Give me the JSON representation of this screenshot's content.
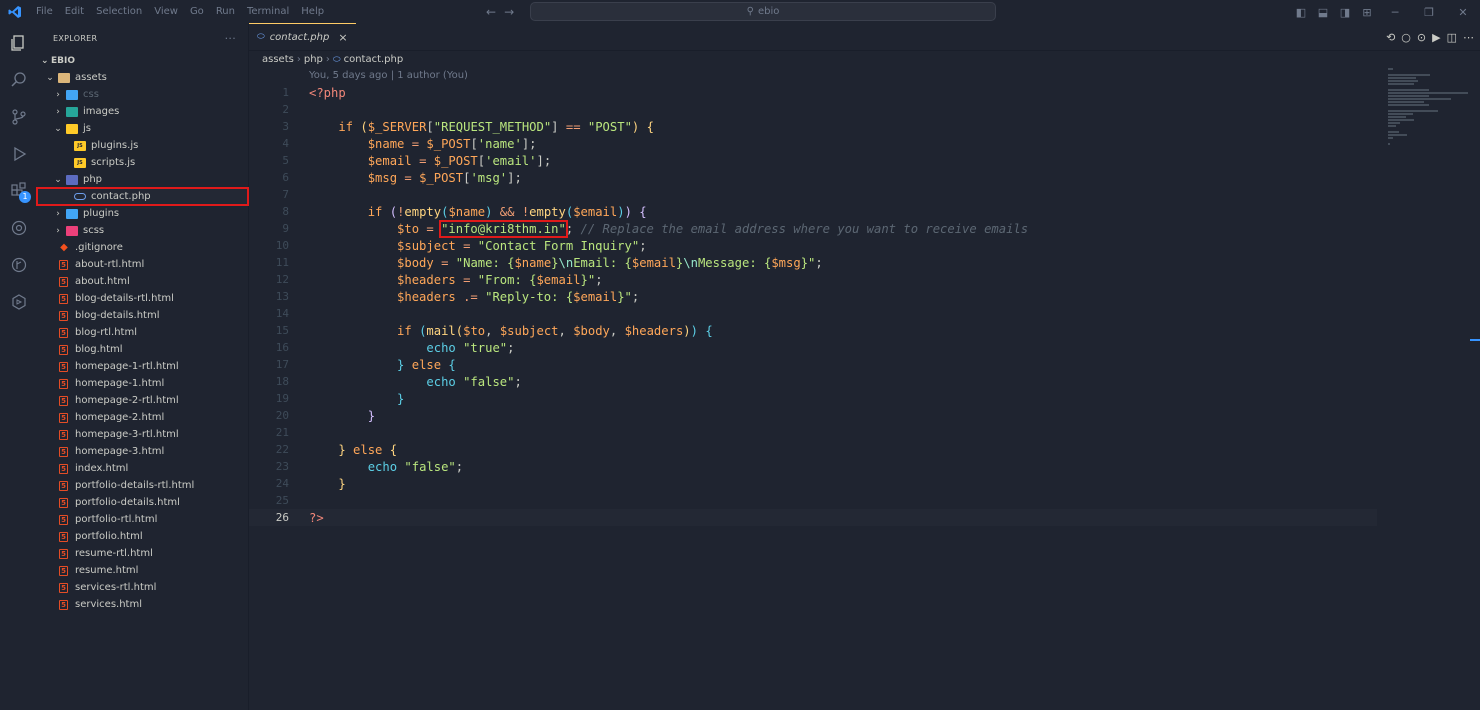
{
  "titlebar": {
    "menu": [
      "File",
      "Edit",
      "Selection",
      "View",
      "Go",
      "Run",
      "Terminal",
      "Help"
    ],
    "search": "ebio"
  },
  "sidebar": {
    "title": "EXPLORER",
    "more": "···",
    "project": "EBIO",
    "tree": [
      {
        "label": "assets",
        "depth": 1,
        "chev": "open",
        "icon": "folder",
        "dim": false
      },
      {
        "label": "css",
        "depth": 2,
        "chev": "closed",
        "icon": "folder-css",
        "dim": true
      },
      {
        "label": "images",
        "depth": 2,
        "chev": "closed",
        "icon": "folder-img",
        "dim": false
      },
      {
        "label": "js",
        "depth": 2,
        "chev": "open",
        "icon": "folder-js",
        "dim": false
      },
      {
        "label": "plugins.js",
        "depth": 3,
        "chev": "",
        "icon": "js",
        "dim": false
      },
      {
        "label": "scripts.js",
        "depth": 3,
        "chev": "",
        "icon": "js",
        "dim": false
      },
      {
        "label": "php",
        "depth": 2,
        "chev": "open",
        "icon": "folder-php",
        "dim": false
      },
      {
        "label": "contact.php",
        "depth": 3,
        "chev": "",
        "icon": "php",
        "dim": false,
        "selected": true
      },
      {
        "label": "plugins",
        "depth": 2,
        "chev": "closed",
        "icon": "folder-plug",
        "dim": false
      },
      {
        "label": "scss",
        "depth": 2,
        "chev": "closed",
        "icon": "folder-scss",
        "dim": false
      },
      {
        "label": ".gitignore",
        "depth": 1,
        "chev": "",
        "icon": "git",
        "dim": false
      },
      {
        "label": "about-rtl.html",
        "depth": 1,
        "chev": "",
        "icon": "html",
        "dim": false
      },
      {
        "label": "about.html",
        "depth": 1,
        "chev": "",
        "icon": "html",
        "dim": false
      },
      {
        "label": "blog-details-rtl.html",
        "depth": 1,
        "chev": "",
        "icon": "html",
        "dim": false
      },
      {
        "label": "blog-details.html",
        "depth": 1,
        "chev": "",
        "icon": "html",
        "dim": false
      },
      {
        "label": "blog-rtl.html",
        "depth": 1,
        "chev": "",
        "icon": "html",
        "dim": false
      },
      {
        "label": "blog.html",
        "depth": 1,
        "chev": "",
        "icon": "html",
        "dim": false
      },
      {
        "label": "homepage-1-rtl.html",
        "depth": 1,
        "chev": "",
        "icon": "html",
        "dim": false
      },
      {
        "label": "homepage-1.html",
        "depth": 1,
        "chev": "",
        "icon": "html",
        "dim": false
      },
      {
        "label": "homepage-2-rtl.html",
        "depth": 1,
        "chev": "",
        "icon": "html",
        "dim": false
      },
      {
        "label": "homepage-2.html",
        "depth": 1,
        "chev": "",
        "icon": "html",
        "dim": false
      },
      {
        "label": "homepage-3-rtl.html",
        "depth": 1,
        "chev": "",
        "icon": "html",
        "dim": false
      },
      {
        "label": "homepage-3.html",
        "depth": 1,
        "chev": "",
        "icon": "html",
        "dim": false
      },
      {
        "label": "index.html",
        "depth": 1,
        "chev": "",
        "icon": "html",
        "dim": false
      },
      {
        "label": "portfolio-details-rtl.html",
        "depth": 1,
        "chev": "",
        "icon": "html",
        "dim": false
      },
      {
        "label": "portfolio-details.html",
        "depth": 1,
        "chev": "",
        "icon": "html",
        "dim": false
      },
      {
        "label": "portfolio-rtl.html",
        "depth": 1,
        "chev": "",
        "icon": "html",
        "dim": false
      },
      {
        "label": "portfolio.html",
        "depth": 1,
        "chev": "",
        "icon": "html",
        "dim": false
      },
      {
        "label": "resume-rtl.html",
        "depth": 1,
        "chev": "",
        "icon": "html",
        "dim": false
      },
      {
        "label": "resume.html",
        "depth": 1,
        "chev": "",
        "icon": "html",
        "dim": false
      },
      {
        "label": "services-rtl.html",
        "depth": 1,
        "chev": "",
        "icon": "html",
        "dim": false
      },
      {
        "label": "services.html",
        "depth": 1,
        "chev": "",
        "icon": "html",
        "dim": false
      }
    ]
  },
  "activitybar": {
    "items": [
      "explorer-icon",
      "search-icon",
      "source-control-icon",
      "run-debug-icon",
      "extensions-icon",
      "remote-icon",
      "git-graph-icon",
      "deploy-icon"
    ],
    "extensions_badge": "1"
  },
  "editor": {
    "tab": {
      "label": "contact.php",
      "close": "×"
    },
    "breadcrumb": [
      "assets",
      "php",
      "contact.php"
    ],
    "blame": "You, 5 days ago | 1 author (You)",
    "current_line": 26,
    "lines": [
      [
        [
          "tok-php",
          "<?php"
        ]
      ],
      [],
      [
        [
          "tok-kw",
          "    if "
        ],
        [
          "tok-brk1",
          "("
        ],
        [
          "tok-var",
          "$_SERVER"
        ],
        [
          "tok-def",
          "["
        ],
        [
          "tok-str",
          "\"REQUEST_METHOD\""
        ],
        [
          "tok-def",
          "] "
        ],
        [
          "tok-op",
          "=="
        ],
        [
          "tok-str",
          " \"POST\""
        ],
        [
          "tok-brk1",
          ")"
        ],
        [
          "tok-def",
          " "
        ],
        [
          "tok-brk1",
          "{"
        ]
      ],
      [
        [
          "tok-var",
          "        $name"
        ],
        [
          "tok-op",
          " = "
        ],
        [
          "tok-var",
          "$_POST"
        ],
        [
          "tok-def",
          "["
        ],
        [
          "tok-str",
          "'name'"
        ],
        [
          "tok-def",
          "];"
        ]
      ],
      [
        [
          "tok-var",
          "        $email"
        ],
        [
          "tok-op",
          " = "
        ],
        [
          "tok-var",
          "$_POST"
        ],
        [
          "tok-def",
          "["
        ],
        [
          "tok-str",
          "'email'"
        ],
        [
          "tok-def",
          "];"
        ]
      ],
      [
        [
          "tok-var",
          "        $msg"
        ],
        [
          "tok-op",
          " = "
        ],
        [
          "tok-var",
          "$_POST"
        ],
        [
          "tok-def",
          "["
        ],
        [
          "tok-str",
          "'msg'"
        ],
        [
          "tok-def",
          "];"
        ]
      ],
      [],
      [
        [
          "tok-kw",
          "        if "
        ],
        [
          "tok-brk2",
          "("
        ],
        [
          "tok-op",
          "!"
        ],
        [
          "tok-fn",
          "empty"
        ],
        [
          "tok-brk3",
          "("
        ],
        [
          "tok-var",
          "$name"
        ],
        [
          "tok-brk3",
          ")"
        ],
        [
          "tok-op",
          " && !"
        ],
        [
          "tok-fn",
          "empty"
        ],
        [
          "tok-brk3",
          "("
        ],
        [
          "tok-var",
          "$email"
        ],
        [
          "tok-brk3",
          ")"
        ],
        [
          "tok-brk2",
          ")"
        ],
        [
          "tok-def",
          " "
        ],
        [
          "tok-brk2",
          "{"
        ]
      ],
      [
        [
          "tok-var",
          "            $to"
        ],
        [
          "tok-op",
          " = "
        ],
        [
          "tok-str highlight-box",
          "\"info@kri8thm.in\""
        ],
        [
          "tok-def",
          ";"
        ],
        [
          "tok-cmt",
          " // Replace the email address where you want to receive emails"
        ]
      ],
      [
        [
          "tok-var",
          "            $subject"
        ],
        [
          "tok-op",
          " = "
        ],
        [
          "tok-str",
          "\"Contact Form Inquiry\""
        ],
        [
          "tok-def",
          ";"
        ]
      ],
      [
        [
          "tok-var",
          "            $body"
        ],
        [
          "tok-op",
          " = "
        ],
        [
          "tok-str",
          "\"Name: {"
        ],
        [
          "tok-var",
          "$name"
        ],
        [
          "tok-str",
          "}"
        ],
        [
          "tok-esc",
          "\\n"
        ],
        [
          "tok-str",
          "Email: {"
        ],
        [
          "tok-var",
          "$email"
        ],
        [
          "tok-str",
          "}"
        ],
        [
          "tok-esc",
          "\\n"
        ],
        [
          "tok-str",
          "Message: {"
        ],
        [
          "tok-var",
          "$msg"
        ],
        [
          "tok-str",
          "}\""
        ],
        [
          "tok-def",
          ";"
        ]
      ],
      [
        [
          "tok-var",
          "            $headers"
        ],
        [
          "tok-op",
          " = "
        ],
        [
          "tok-str",
          "\"From: {"
        ],
        [
          "tok-var",
          "$email"
        ],
        [
          "tok-str",
          "}\""
        ],
        [
          "tok-def",
          ";"
        ]
      ],
      [
        [
          "tok-var",
          "            $headers"
        ],
        [
          "tok-op",
          " .= "
        ],
        [
          "tok-str",
          "\"Reply-to: {"
        ],
        [
          "tok-var",
          "$email"
        ],
        [
          "tok-str",
          "}\""
        ],
        [
          "tok-def",
          ";"
        ]
      ],
      [],
      [
        [
          "tok-kw",
          "            if "
        ],
        [
          "tok-brk3",
          "("
        ],
        [
          "tok-fn",
          "mail"
        ],
        [
          "tok-brk1",
          "("
        ],
        [
          "tok-var",
          "$to"
        ],
        [
          "tok-def",
          ", "
        ],
        [
          "tok-var",
          "$subject"
        ],
        [
          "tok-def",
          ", "
        ],
        [
          "tok-var",
          "$body"
        ],
        [
          "tok-def",
          ", "
        ],
        [
          "tok-var",
          "$headers"
        ],
        [
          "tok-brk1",
          ")"
        ],
        [
          "tok-brk3",
          ")"
        ],
        [
          "tok-def",
          " "
        ],
        [
          "tok-brk3",
          "{"
        ]
      ],
      [
        [
          "tok-tag",
          "                echo "
        ],
        [
          "tok-str",
          "\"true\""
        ],
        [
          "tok-def",
          ";"
        ]
      ],
      [
        [
          "tok-brk3",
          "            }"
        ],
        [
          "tok-kw",
          " else "
        ],
        [
          "tok-brk3",
          "{"
        ]
      ],
      [
        [
          "tok-tag",
          "                echo "
        ],
        [
          "tok-str",
          "\"false\""
        ],
        [
          "tok-def",
          ";"
        ]
      ],
      [
        [
          "tok-brk3",
          "            }"
        ]
      ],
      [
        [
          "tok-brk2",
          "        }"
        ]
      ],
      [],
      [
        [
          "tok-brk1",
          "    }"
        ],
        [
          "tok-kw",
          " else "
        ],
        [
          "tok-brk1",
          "{"
        ]
      ],
      [
        [
          "tok-tag",
          "        echo "
        ],
        [
          "tok-str",
          "\"false\""
        ],
        [
          "tok-def",
          ";"
        ]
      ],
      [
        [
          "tok-brk1",
          "    }"
        ]
      ],
      [],
      [
        [
          "tok-php",
          "?>"
        ]
      ]
    ]
  }
}
